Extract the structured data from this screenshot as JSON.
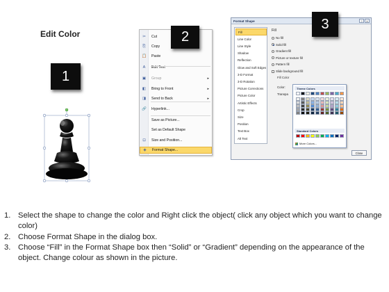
{
  "title": "Edit Color",
  "badges": [
    "1",
    "2",
    "3"
  ],
  "context_menu": {
    "items": [
      {
        "label": "Cut",
        "icon": "scissors-icon",
        "glyph": "✂",
        "disabled": false,
        "submenu": false
      },
      {
        "label": "Copy",
        "icon": "copy-icon",
        "glyph": "⎘",
        "disabled": false,
        "submenu": false
      },
      {
        "label": "Paste",
        "icon": "paste-icon",
        "glyph": "📋",
        "disabled": false,
        "submenu": false
      },
      {
        "label": "Edit Text",
        "icon": "text-icon",
        "glyph": "A",
        "disabled": false,
        "submenu": false
      },
      {
        "label": "Group",
        "icon": "group-icon",
        "glyph": "▣",
        "disabled": true,
        "submenu": true
      },
      {
        "label": "Bring to Front",
        "icon": "bring-front-icon",
        "glyph": "◧",
        "disabled": false,
        "submenu": true
      },
      {
        "label": "Send to Back",
        "icon": "send-back-icon",
        "glyph": "◨",
        "disabled": false,
        "submenu": true
      },
      {
        "label": "Hyperlink...",
        "icon": "hyperlink-icon",
        "glyph": "🔗",
        "disabled": false,
        "submenu": false
      },
      {
        "label": "Save as Picture...",
        "icon": "",
        "glyph": "",
        "disabled": false,
        "submenu": false
      },
      {
        "label": "Set as Default Shape",
        "icon": "",
        "glyph": "",
        "disabled": false,
        "submenu": false
      },
      {
        "label": "Size and Position...",
        "icon": "size-icon",
        "glyph": "⊡",
        "disabled": false,
        "submenu": false
      },
      {
        "label": "Format Shape...",
        "icon": "format-shape-icon",
        "glyph": "◈",
        "disabled": false,
        "submenu": false,
        "highlighted": true
      }
    ]
  },
  "dialog": {
    "title": "Format Shape",
    "title_buttons": [
      "?",
      "X"
    ],
    "nav": [
      "Fill",
      "Line Color",
      "Line Style",
      "Shadow",
      "Reflection",
      "Glow and Soft Edges",
      "3-D Format",
      "3-D Rotation",
      "Picture Corrections",
      "Picture Color",
      "Artistic Effects",
      "Crop",
      "Size",
      "Position",
      "Text Box",
      "Alt Text"
    ],
    "selected_nav": "Fill",
    "pane_heading": "Fill",
    "options": [
      {
        "label": "No fill",
        "type": "radio",
        "on": false
      },
      {
        "label": "Solid fill",
        "type": "radio",
        "on": true
      },
      {
        "label": "Gradient fill",
        "type": "radio",
        "on": false
      },
      {
        "label": "Picture or texture fill",
        "type": "radio",
        "on": false
      },
      {
        "label": "Pattern fill",
        "type": "radio",
        "on": false
      },
      {
        "label": "Slide background fill",
        "type": "checkbox",
        "on": false
      }
    ],
    "group_label": "Fill Color",
    "color_label": "Color:",
    "transparency_label": "Transpa",
    "palette": {
      "theme_heading": "Theme Colors",
      "standard_heading": "Standard Colors",
      "more_label": "More Colors...",
      "theme_top": [
        "#ffffff",
        "#000000",
        "#eeece1",
        "#1f497d",
        "#4f81bd",
        "#c0504d",
        "#9bbb59",
        "#8064a2",
        "#4bacc6",
        "#f79646"
      ],
      "theme_shades": [
        [
          "#f2f2f2",
          "#7f7f7f",
          "#ddd9c3",
          "#c6d9f0",
          "#dbe5f1",
          "#f2dcdb",
          "#ebf1dd",
          "#e5e0ec",
          "#dbeef3",
          "#fdeada"
        ],
        [
          "#d8d8d8",
          "#595959",
          "#c4bd97",
          "#8db3e2",
          "#b8cce4",
          "#e5b9b7",
          "#d7e3bc",
          "#ccc1d9",
          "#b7dde8",
          "#fbd5b5"
        ],
        [
          "#bfbfbf",
          "#3f3f3f",
          "#938953",
          "#548dd4",
          "#95b3d7",
          "#d99694",
          "#c3d69b",
          "#b2a2c7",
          "#92cddc",
          "#fac08f"
        ],
        [
          "#a5a5a5",
          "#262626",
          "#494429",
          "#17365d",
          "#366092",
          "#953734",
          "#76923c",
          "#5f497a",
          "#31859b",
          "#e36c09"
        ],
        [
          "#7f7f7f",
          "#0c0c0c",
          "#1d1b10",
          "#0f243e",
          "#244061",
          "#632423",
          "#4f6128",
          "#3f3151",
          "#205867",
          "#974806"
        ]
      ],
      "standard": [
        "#c00000",
        "#ff0000",
        "#ffc000",
        "#ffff00",
        "#92d050",
        "#00b050",
        "#00b0f0",
        "#0070c0",
        "#002060",
        "#7030a0"
      ]
    },
    "close_label": "Close"
  },
  "steps": [
    {
      "num": "1.",
      "text": "Select the shape to change the color and Right click the object( click any object which you want to change color)"
    },
    {
      "num": "2.",
      "text": "Choose Format Shape in the dialog box."
    },
    {
      "num": "3.",
      "text": "Choose “Fill” in the Format Shape box then “Solid” or “Gradient” depending on the appearance of the object. Change colour as shown in the picture."
    }
  ]
}
